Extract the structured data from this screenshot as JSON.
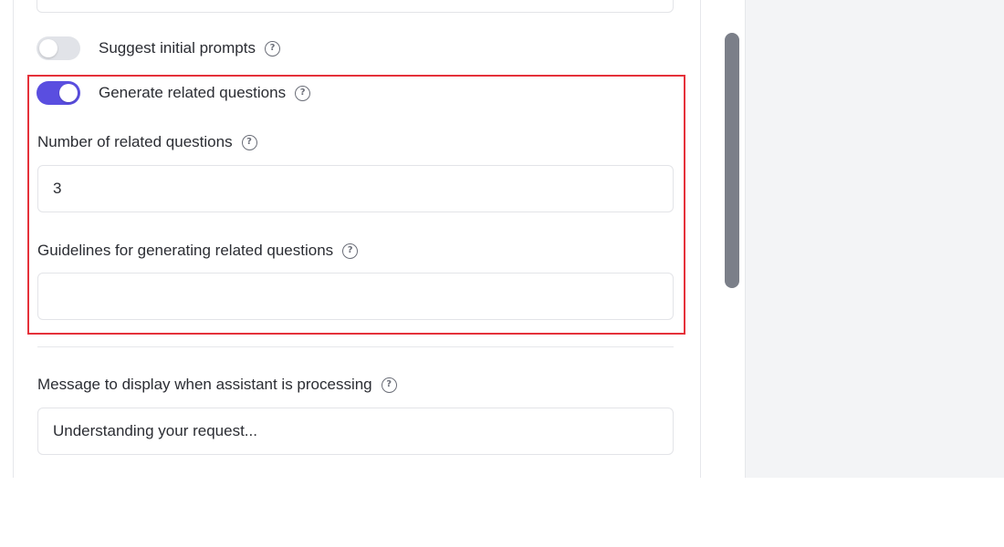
{
  "settings": {
    "suggest_prompts": {
      "label": "Suggest initial prompts",
      "enabled": false
    },
    "related_questions": {
      "label": "Generate related questions",
      "enabled": true
    },
    "num_related": {
      "label": "Number of related questions",
      "value": "3"
    },
    "guidelines": {
      "label": "Guidelines for generating related questions",
      "value": ""
    },
    "processing_message": {
      "label": "Message to display when assistant is processing",
      "value": "Understanding your request..."
    }
  },
  "help_glyph": "?",
  "colors": {
    "toggle_on": "#5a4ee0",
    "toggle_off": "#e1e3e8",
    "highlight": "#e5313a",
    "scrollbar": "#7b7f89"
  }
}
